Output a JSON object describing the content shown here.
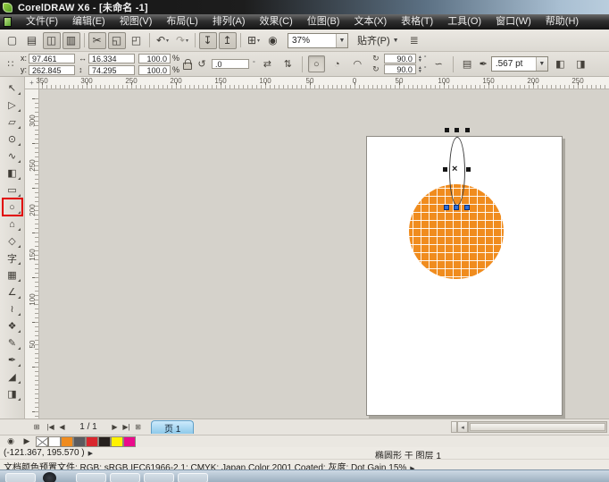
{
  "titlebar": {
    "title": "CorelDRAW X6 - [未命名 -1]"
  },
  "menubar": {
    "items": [
      "文件(F)",
      "编辑(E)",
      "视图(V)",
      "布局(L)",
      "排列(A)",
      "效果(C)",
      "位图(B)",
      "文本(X)",
      "表格(T)",
      "工具(O)",
      "窗口(W)",
      "帮助(H)"
    ]
  },
  "toolbar": {
    "buttons": [
      {
        "name": "new-document-button",
        "glyph": "▢"
      },
      {
        "name": "open-button",
        "glyph": "▤"
      },
      {
        "name": "save-button",
        "glyph": "◫",
        "cls": "boxed"
      },
      {
        "name": "print-button",
        "glyph": "▥",
        "cls": "boxed"
      },
      {
        "name": "separator",
        "cls": "sep"
      },
      {
        "name": "cut-button",
        "glyph": "✂",
        "cls": "boxed"
      },
      {
        "name": "copy-button",
        "glyph": "◱",
        "cls": "boxed"
      },
      {
        "name": "paste-button",
        "glyph": "◰"
      },
      {
        "name": "separator",
        "cls": "sep"
      },
      {
        "name": "undo-button",
        "glyph": "↶",
        "caret": "▾"
      },
      {
        "name": "redo-button",
        "glyph": "↷",
        "caret": "▾",
        "cls": "dim"
      },
      {
        "name": "separator",
        "cls": "sep"
      },
      {
        "name": "import-button",
        "glyph": "↧",
        "cls": "boxed"
      },
      {
        "name": "export-button",
        "glyph": "↥",
        "cls": "boxed"
      },
      {
        "name": "separator",
        "cls": "sep"
      },
      {
        "name": "application-launcher-button",
        "glyph": "⊞",
        "caret": "▾"
      },
      {
        "name": "welcome-screen-button",
        "glyph": "◉"
      }
    ],
    "zoom_level": "37%",
    "snap_label": "贴齐(P)",
    "options_glyph": "≣"
  },
  "propbar": {
    "x_label": "x:",
    "x_value": "97.461 mm",
    "y_label": "y:",
    "y_value": "262.845 mm",
    "width_icon": "↔",
    "width_value": "16.334 mm",
    "height_icon": "↕",
    "height_value": "74.295 mm",
    "scale_x": "100.0",
    "scale_y": "100.0",
    "percent": "%",
    "rotation_icon": "↺",
    "rotation_value": ".0",
    "rotation_unit": "°",
    "mirror_h_glyph": "⇄",
    "mirror_v_glyph": "⇅",
    "ellipse_glyph": "○",
    "pie_glyph": "◔",
    "arc_glyph": "◠",
    "pie_icon": "↻",
    "pie_start": "90.0",
    "pie_end": "90.0",
    "swap_glyph": "∽",
    "wrap_glyph": "▤",
    "outline_width": ".567 pt",
    "right_glyph_1": "◧",
    "right_glyph_2": "◨"
  },
  "rulers": {
    "origin_glyph": "+",
    "h_labels": [
      "350",
      "300",
      "250",
      "200",
      "150",
      "100",
      "50",
      "0",
      "50",
      "100",
      "150",
      "200",
      "250"
    ],
    "v_labels": [
      "300",
      "250",
      "200",
      "150",
      "100",
      "50"
    ]
  },
  "toolbox": {
    "tools": [
      {
        "name": "pick-tool",
        "glyph": "↖"
      },
      {
        "name": "shape-tool",
        "glyph": "▷"
      },
      {
        "name": "crop-tool",
        "glyph": "▱"
      },
      {
        "name": "zoom-tool",
        "glyph": "⊙"
      },
      {
        "name": "freehand-tool",
        "glyph": "∿"
      },
      {
        "name": "smart-fill-tool",
        "glyph": "◧"
      },
      {
        "name": "rectangle-tool",
        "glyph": "▭"
      },
      {
        "name": "ellipse-tool",
        "glyph": "○",
        "cls": "highlighted"
      },
      {
        "name": "polygon-tool",
        "glyph": "⌂"
      },
      {
        "name": "basic-shapes-tool",
        "glyph": "◇"
      },
      {
        "name": "text-tool",
        "glyph": "字"
      },
      {
        "name": "table-tool",
        "glyph": "▦"
      },
      {
        "name": "dimension-tool",
        "glyph": "∠"
      },
      {
        "name": "connector-tool",
        "glyph": "≀"
      },
      {
        "name": "blend-tool",
        "glyph": "❖"
      },
      {
        "name": "color-eyedropper-tool",
        "glyph": "✎"
      },
      {
        "name": "outline-pen-tool",
        "glyph": "✒"
      },
      {
        "name": "fill-tool",
        "glyph": "◢"
      },
      {
        "name": "interactive-fill-tool",
        "glyph": "◨"
      }
    ]
  },
  "colors": {
    "circle_fill": "#F08C1E",
    "handle_blue": "#2f6fd8",
    "tool_highlight": "#e10000"
  },
  "pagenav": {
    "add_page_glyph": "⊞",
    "first_glyph": "|◀",
    "prev_glyph": "◀",
    "indicator": "1 / 1",
    "next_glyph": "▶",
    "last_glyph": "▶|",
    "add_page2_glyph": "⊞",
    "tab_label": "页 1",
    "scroll_left_glyph": "◂"
  },
  "palette": {
    "radio_glyph": "◉",
    "picker_glyph": "▶",
    "swatches": [
      {
        "name": "no-color",
        "cls": "none",
        "hex": ""
      },
      {
        "name": "white",
        "hex": "#FFFFFF"
      },
      {
        "name": "orange",
        "hex": "#F08C1E"
      },
      {
        "name": "gray",
        "hex": "#5B5B5F"
      },
      {
        "name": "red",
        "hex": "#D9272E"
      },
      {
        "name": "black",
        "hex": "#26201D"
      },
      {
        "name": "yellow",
        "hex": "#FFF200"
      },
      {
        "name": "magenta",
        "hex": "#EA0B8C"
      }
    ]
  },
  "statusbar": {
    "coords": "(-121.367, 195.570 )",
    "coords_arrow": "▶",
    "object_info": "椭圆形 于 图层 1",
    "doc_profile": "文档颜色预置文件: RGB: sRGB IEC61966-2.1; CMYK: Japan Color 2001 Coated; 灰度: Dot Gain 15%",
    "profile_arrow": "▶"
  }
}
